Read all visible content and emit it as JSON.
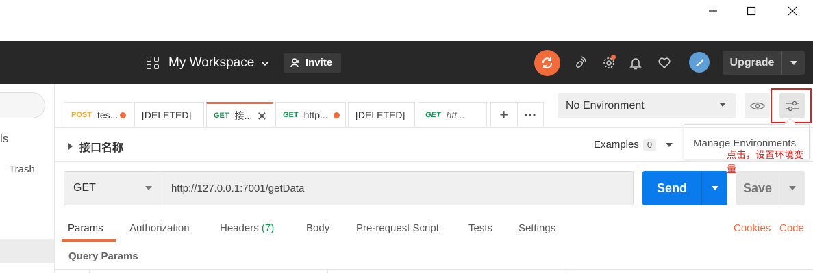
{
  "header": {
    "workspace": "My Workspace",
    "invite_label": "Invite",
    "upgrade_label": "Upgrade"
  },
  "sidebar": {
    "partial_label": "ls",
    "trash_label": "Trash"
  },
  "tabs": [
    {
      "method": "POST",
      "title": "tes...",
      "modified": true
    },
    {
      "method": "",
      "title": "[DELETED]",
      "modified": false
    },
    {
      "method": "GET",
      "title": "接...",
      "active": true
    },
    {
      "method": "GET",
      "title": "http...",
      "modified": true
    },
    {
      "method": "",
      "title": "[DELETED]",
      "modified": false
    },
    {
      "method": "GET",
      "title": "htt...",
      "modified": false
    }
  ],
  "environment": {
    "selected": "No Environment",
    "tooltip": "Manage Environments",
    "annotation": "点击，设置环境变量"
  },
  "request": {
    "name": "接口名称",
    "examples_label": "Examples",
    "examples_count": "0",
    "method": "GET",
    "url": "http://127.0.0.1:7001/getData",
    "send_label": "Send",
    "save_label": "Save"
  },
  "subtabs": {
    "params": "Params",
    "authorization": "Authorization",
    "headers": "Headers",
    "headers_count": "(7)",
    "body": "Body",
    "prerequest": "Pre-request Script",
    "tests": "Tests",
    "settings": "Settings",
    "cookies": "Cookies",
    "code": "Code"
  },
  "query_params_label": "Query Params",
  "colors": {
    "accent": "#f26b3a",
    "send_blue": "#097bed",
    "header_bg": "#282828",
    "annotation_red": "#e0201b",
    "get_green": "#0b9b4f",
    "post_yellow": "#f5a623"
  }
}
